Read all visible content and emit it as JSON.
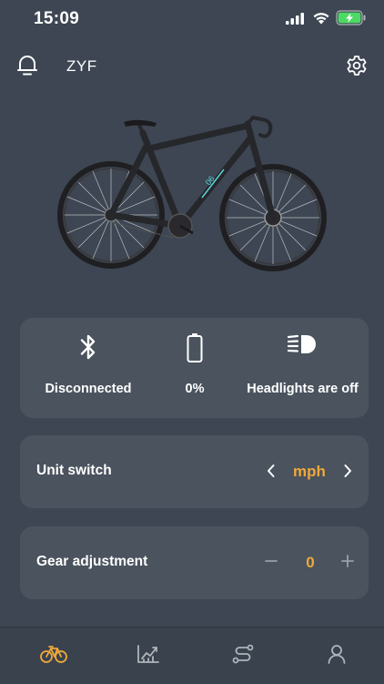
{
  "status_bar": {
    "time": "15:09"
  },
  "header": {
    "user_name": "ZYF"
  },
  "status": {
    "bluetooth": "Disconnected",
    "battery": "0%",
    "headlights": "Headlights are off"
  },
  "unit_switch": {
    "label": "Unit switch",
    "value": "mph"
  },
  "gear_adjustment": {
    "label": "Gear adjustment",
    "value": "0"
  },
  "colors": {
    "background": "#3d4652",
    "card": "#4a535e",
    "accent": "#f0a83a"
  },
  "tabs": [
    "bike-icon",
    "chart-icon",
    "route-icon",
    "profile-icon"
  ]
}
